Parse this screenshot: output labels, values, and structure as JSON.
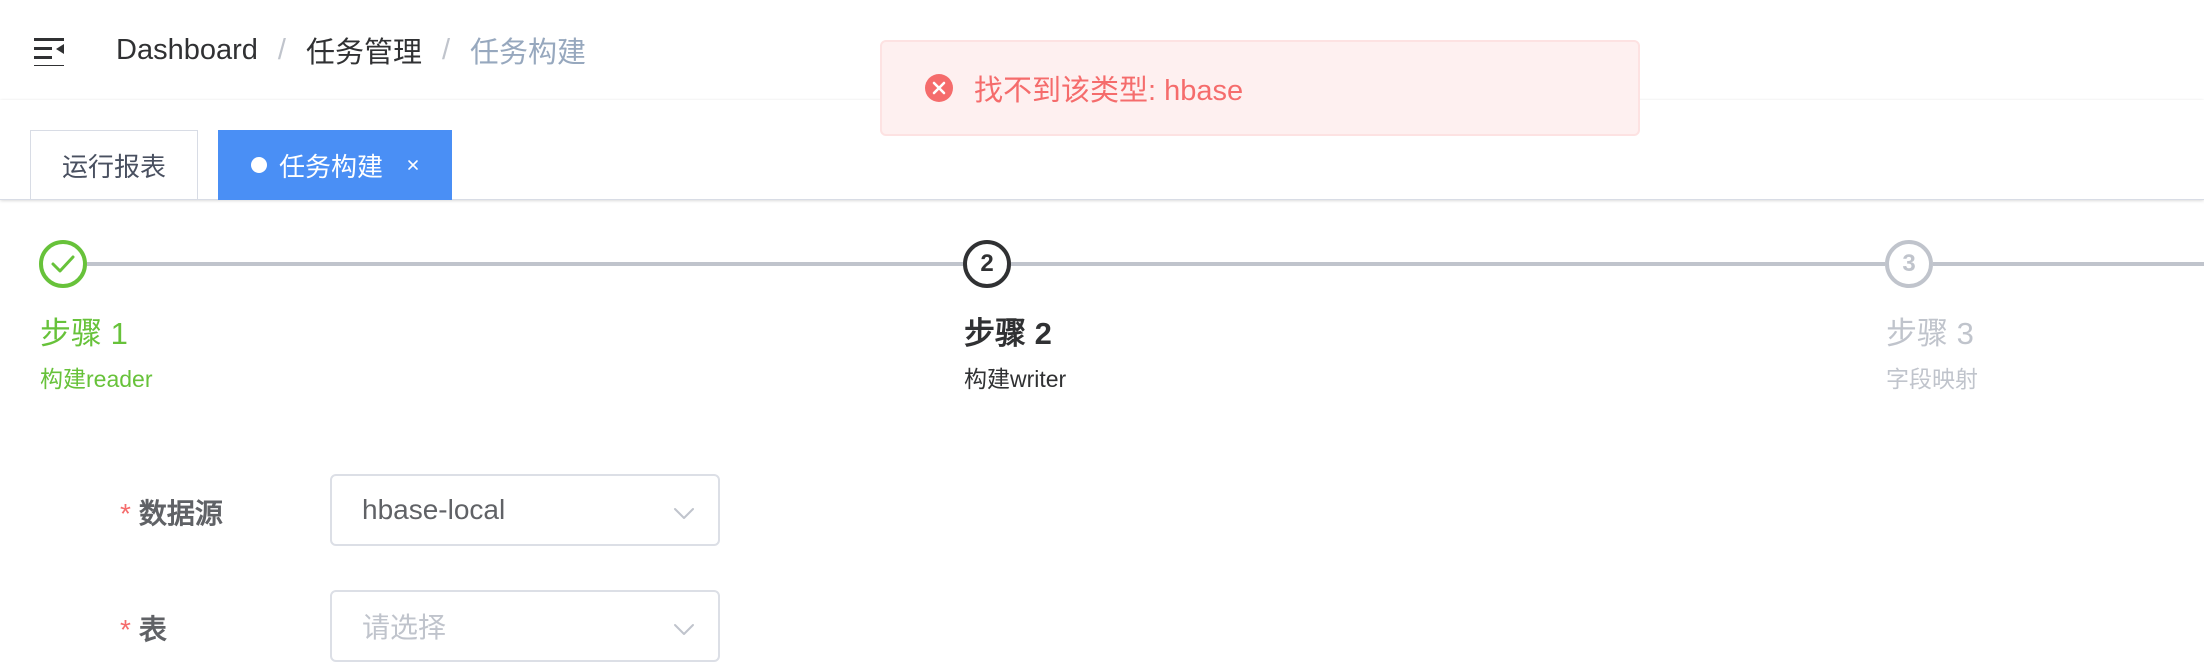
{
  "breadcrumb": {
    "items": [
      "Dashboard",
      "任务管理",
      "任务构建"
    ],
    "separator": "/"
  },
  "message": {
    "type": "error",
    "text": "找不到该类型: hbase"
  },
  "tags": [
    {
      "label": "运行报表",
      "active": false
    },
    {
      "label": "任务构建",
      "active": true
    }
  ],
  "steps": [
    {
      "number": "1",
      "title": "步骤 1",
      "description": "构建reader",
      "status": "finish"
    },
    {
      "number": "2",
      "title": "步骤 2",
      "description": "构建writer",
      "status": "process"
    },
    {
      "number": "3",
      "title": "步骤 3",
      "description": "字段映射",
      "status": "wait"
    }
  ],
  "form": {
    "datasource": {
      "label": "数据源",
      "value": "hbase-local"
    },
    "table": {
      "label": "表",
      "placeholder": "请选择"
    }
  },
  "colors": {
    "primary": "#4a8ff5",
    "success": "#67c23a",
    "error": "#f56c6c",
    "muted": "#c0c4cc"
  }
}
